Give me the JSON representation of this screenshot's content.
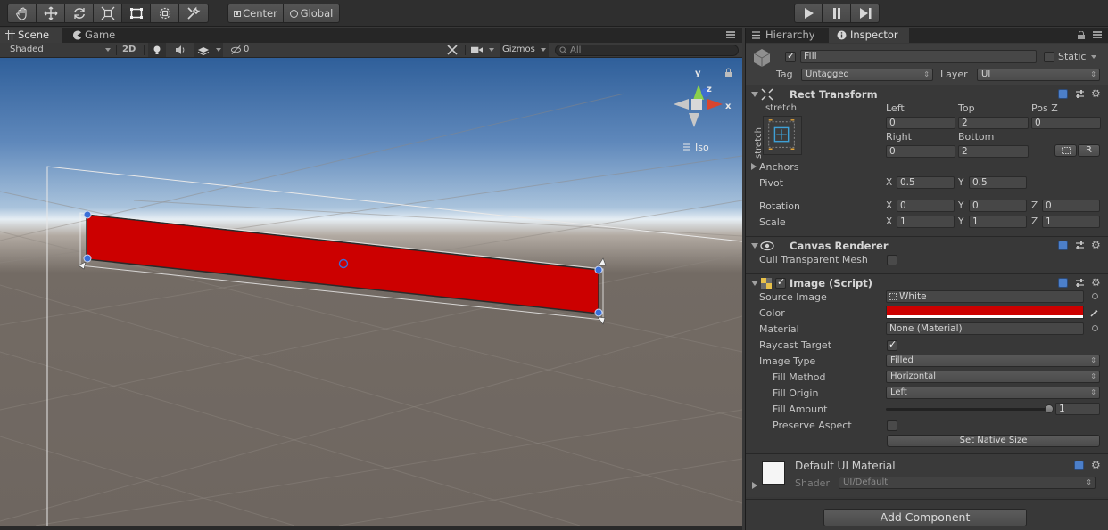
{
  "toolbar": {
    "pivot_label": "Center",
    "space_label": "Global"
  },
  "scene_panel": {
    "tabs": [
      {
        "label": "Scene",
        "icon": "hash-grid-icon",
        "active": true
      },
      {
        "label": "Game",
        "icon": "pacman-icon",
        "active": false
      }
    ],
    "shading_mode": "Shaded",
    "mode_2d": "2D",
    "hidden_count": "0",
    "gizmos_label": "Gizmos",
    "search_placeholder": "All",
    "projection_label": "Iso",
    "gizmo_axes": {
      "x": "x",
      "y": "y",
      "z": "z"
    },
    "fill_color": "#cc0000"
  },
  "right_panel": {
    "tabs": [
      {
        "label": "Hierarchy",
        "icon": "list-icon",
        "active": false
      },
      {
        "label": "Inspector",
        "icon": "info-icon",
        "active": true
      }
    ]
  },
  "inspector": {
    "object_name": "Fill",
    "object_active": true,
    "static_label": "Static",
    "tag_label": "Tag",
    "tag_value": "Untagged",
    "layer_label": "Layer",
    "layer_value": "UI",
    "rect_transform": {
      "title": "Rect Transform",
      "anchor_h": "stretch",
      "anchor_v": "stretch",
      "left_label": "Left",
      "left": "0",
      "top_label": "Top",
      "top": "2",
      "posz_label": "Pos Z",
      "posz": "0",
      "right_label": "Right",
      "right": "0",
      "bottom_label": "Bottom",
      "bottom": "2",
      "r_button": "R",
      "anchors_label": "Anchors",
      "pivot_label": "Pivot",
      "pivot_x": "0.5",
      "pivot_y": "0.5",
      "rotation_label": "Rotation",
      "rot_x": "0",
      "rot_y": "0",
      "rot_z": "0",
      "scale_label": "Scale",
      "scale_x": "1",
      "scale_y": "1",
      "scale_z": "1",
      "axis_x": "X",
      "axis_y": "Y",
      "axis_z": "Z"
    },
    "canvas_renderer": {
      "title": "Canvas Renderer",
      "cull_label": "Cull Transparent Mesh",
      "cull_value": false
    },
    "image": {
      "title": "Image (Script)",
      "enabled": true,
      "source_image_label": "Source Image",
      "source_image": "White",
      "color_label": "Color",
      "color_value": "#cc0000",
      "material_label": "Material",
      "material": "None (Material)",
      "raycast_label": "Raycast Target",
      "raycast": true,
      "image_type_label": "Image Type",
      "image_type": "Filled",
      "fill_method_label": "Fill Method",
      "fill_method": "Horizontal",
      "fill_origin_label": "Fill Origin",
      "fill_origin": "Left",
      "fill_amount_label": "Fill Amount",
      "fill_amount": "1",
      "fill_amount_fraction": 1.0,
      "preserve_aspect_label": "Preserve Aspect",
      "preserve_aspect": false,
      "native_size_button": "Set Native Size"
    },
    "material_preview": {
      "name": "Default UI Material",
      "shader_label": "Shader",
      "shader_value": "UI/Default"
    },
    "add_component_button": "Add Component"
  }
}
